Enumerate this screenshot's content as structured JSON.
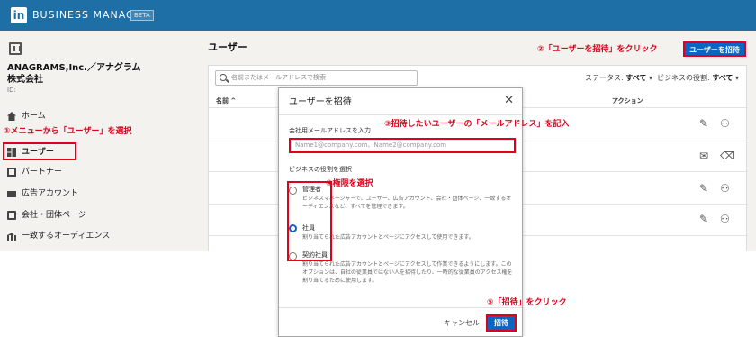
{
  "header": {
    "logo": "in",
    "brand": "BUSINESS MANAGER",
    "badge": "BETA"
  },
  "sidebar": {
    "company_name": "ANAGRAMS,Inc.／アナグラム株式会社",
    "company_id": "ID:",
    "items": [
      {
        "label": "ホーム",
        "icon": "home-icon"
      },
      {
        "label": "ユーザー",
        "icon": "users-icon"
      },
      {
        "label": "パートナー",
        "icon": "partner-icon"
      },
      {
        "label": "広告アカウント",
        "icon": "ad-account-icon"
      },
      {
        "label": "会社・団体ページ",
        "icon": "company-page-icon"
      },
      {
        "label": "一致するオーディエンス",
        "icon": "audience-icon"
      }
    ]
  },
  "main": {
    "title": "ユーザー",
    "invite_button": "ユーザーを招待",
    "search_placeholder": "名前またはメールアドレスで検索",
    "filter_status_label": "ステータス:",
    "filter_status_value": "すべて",
    "filter_role_label": "ビジネスの役割:",
    "filter_role_value": "すべて",
    "columns": {
      "name": "名前 ^",
      "action": "アクション"
    }
  },
  "modal": {
    "title": "ユーザーを招待",
    "close": "✕",
    "email_label": "会社用メールアドレスを入力",
    "email_placeholder": "Name1@company.com、Name2@company.com",
    "role_label": "ビジネスの役割を選択",
    "roles": [
      {
        "name": "管理者",
        "desc": "ビジネスマネージャーで、ユーザー、広告アカウント、会社・団体ページ、一致するオーディエンスなど、すべてを管理できます。",
        "checked": false
      },
      {
        "name": "社員",
        "desc": "割り当てられた広告アカウントとページにアクセスして使用できます。",
        "checked": true
      },
      {
        "name": "契約社員",
        "desc": "割り当てられた広告アカウントとページにアクセスして作業できるようにします。このオプションは、自社の従業員ではない人を招待したり、一時的な従業員のアクセス権を割り当てるために使用します。",
        "checked": false
      }
    ],
    "cancel": "キャンセル",
    "invite": "招待"
  },
  "annotations": {
    "step1": "①メニューから「ユーザー」を選択",
    "step2": "②「ユーザーを招待」をクリック",
    "step3": "③招待したいユーザーの「メールアドレス」を記入",
    "step4": "④権限を選択",
    "step5": "⑤「招待」をクリック"
  },
  "colors": {
    "header": "#1d6fa5",
    "primary": "#0a66c2",
    "annotation": "#e0001b"
  }
}
